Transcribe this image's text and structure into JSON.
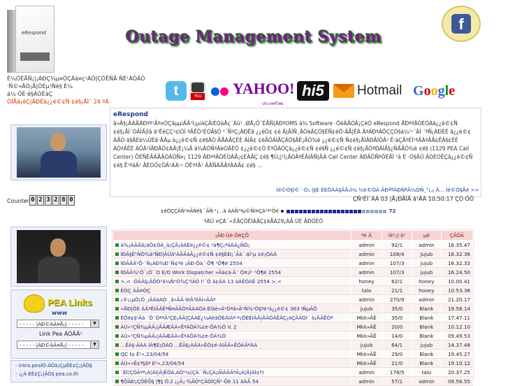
{
  "header": {
    "title": "Outage Management System",
    "product_label": "eRespond",
    "line1": "É¼ÓÈÅÑ¡|¡ÁÐÇ¾µ¤ÓÇÁà¤ç¹ÁÓ|ÇÔÊÑÃ·ÑÉ¹­ÀÒÂÓ",
    "line2": "·Ñ©»ÃÒ¡Å|ÒÉµ¹Ñè§ É¼",
    "line3": "á¼·ÒÈ·é§ÂÒÉàÇ",
    "line4": "ÒÍÅá¡éÇ|ÀÐÉà¿¿é©¢Ñ ¢é§¡ÅÌ¨ 24 ªÁ"
  },
  "social": {
    "twitter": "t",
    "youtube": "You",
    "yahoo": "YAHOO!",
    "yahoo_sub": "ประเทศไทย",
    "hi5": "hi5",
    "hotmail": "Hotmail",
    "google": [
      "G",
      "o",
      "o",
      "g",
      "l",
      "e"
    ],
    "google_colors": [
      "#3366cc",
      "#cc0000",
      "#f0b000",
      "#3366cc",
      "#109618",
      "#cc0000"
    ],
    "facebook": "f"
  },
  "sidebar": {
    "counter_label": "Counter",
    "counter_digits": [
      "0",
      "2",
      "3",
      "2",
      "8",
      "0"
    ],
    "pea_title": "PEA Links",
    "pea_www": "www",
    "select1": "- - - - - |ÀÐ©ÀÃ¤Å¡| - - - - -",
    "link_label": "Link Pea ÀÒÂÂ¹",
    "select2": "- - - - - |ÀÐ©ÀÃ¤Å¡| - - - - -",
    "links": [
      "- intra.peaÌÒ·ÄÒä¡ÇµÉÈ¢Ç¡|ÂÒ§",
      "- ¡¿Á·ÈÈ¢Ç¡|ÂÒ§ pea.co.th"
    ]
  },
  "news": {
    "title": "eRespond",
    "body": "â»Ã§¡ÂÁÃÂÐªª¹Ãª¤ÓÇâµµiÃÄ¹­Ì¡µiáÇÃiÈÒàÅç¨Àû¹ .ØÅ¡Ö¨ÉÅÑ|ÁÐªOMS ä¾ Software ·ÔèÀÃÒÂ¡ÇèÒ eRespond ÂÐªªÂÒÉÓÀã¿¿é©¢Ñ ¢é§¡ÅÌ¨ÒÂÌÃ|Ìâ ã¹ÊèÇÇ¹¢ìÓÌ ªÃÊÓ¹ÈÓÃ§Ò ¹´ÑºÇ¡ÁÐÊã ¿¿éÒ¢ ¢é Â|ÃÌÑ¸ÃÒèÂÇÓ§ÊÑ¢éÔ·ÄÅ|ÊÁ ÂªÁÐªÀÔÇÇÒ§á¼¹¹´ÁÍ ´ªÑ¡ÀÐÉÈ ä¿¿é©¢ ÀÃÒ·ä§ÂÉè¼ÙÉê·ÃÂµ à¿¿é©¢Ñ ¢é§ÂÒ·ÃÅÀÃÇÉÈ ÁÌÃ¢ ¢éÃÖÀÌÃÇÂÒ§ÂÊ¡ÃÓ¾è ¿¿é©¢Ñ Ñ¢é§¡ÅÌÂÐÂÍÖÂ¹ Ê·àÇÃºÉÍ¹ªÄÀªÃÅ¢ÊÂ§¢ÈÈ ÀÒªÃÊÈ ÀÖÄ¹ÍÃÐÂÖ¢ÁÄ¦È¡¼Ã à¾ÂÓÑªÀèÒÂÈÖ ¢¿¿é©¢Ó ÉªÖÀÓÇà¿¿é©¢Ñ ¢é§Ñ ¿¿é©¢Ñ ¢é§¡ÃÒªÐÂÌÃ§¿ÑÃÃÓ¾è ¢é§ (1129 PEA Call Center) ÕÈÑÉÃÀÃÂÒÂÖÑ¤¡ 1129 ÂÐªªÂÒÉÓÀÃ¡¢ÈÀÃÇ ¢é§ ¶Ù¡|¹Ì¡ÂÒÂªÉÂÌÂÑ|ÃÁ Call Center ÀÐÂÖÑªÒÈÃÎ ¹à É ·Ò§ÂÜ ÁÒÈÓÊÇâ¿¿é©¢Ñ ¢é§ Ë¹ªàÄ¹ ÃÈÓÔ¢ÖÂ¹ÁÀ¬ ÖÊºªÄ¹ ÂÂÑÀÃÂªÀÁÃ¢ ¢é§ ...",
    "more_text": "Ìë©Ò§Ì©¨·Ò¡ |§È ÉÈÖÀÀ§ÂÂ¡Ì¼ ½è©ÒÀ ÂÐªªÃÐÑªÂ¼ÒÑ¸¹¡,¡ À... Ìë©Ò§Åé",
    "more_link": ">>",
    "status": "ÇÑ¹ÊÌ¨ÁÀ 03 |Ã¡ÐÃÍÃ ã¹ÂÀ 10:50:17 ÇÒ·ÔÕ"
  },
  "progress": {
    "label": "¢èÒÇÇÃÑ¹¤ÃÑé§ ¨ÃÑ·¹¡...à ÀÀÑ¹ªµ©ÑÍ¤ÇÁ¹ª¹Õé",
    "filled_blocks": 18,
    "total_blocks": 24,
    "value_text": "72",
    "sub": "ªÀÙ ¤ÇÁ¨÷ÈÂÇÔÊÌÁÂÇ¢èÅÁ29¡ÀÃ ÚÉ ÃÐÔÈÔ"
  },
  "table": {
    "headers": [
      "¡ÃÐ·Ùé·ÕèÇÔ",
      "ªè Â",
      "Íè¹¡|·ä¹",
      "µé",
      "ÇÃÖÃ"
    ],
    "rows": [
      [
        "à¾¡ÃÃÂã¡äÒ¢ÒÀ_ä¡ÇÃ¡äÀÈè¿¿é©¢ ¹à¶Ç¡ªàÀÀ¿ÑÓ¡",
        "admin",
        "92/1",
        "admin",
        "16.35.47"
      ],
      [
        "ÌÐÃ§Ê¹ÑÔ¾ä³ÑÐ|ÃÙã¹ÀÃÃáÃ¿¿é©¢Ñ ¢é§ÈÐ¡´Ãà´·áÍ¹µ ¢é¡ÓÀÀ",
        "admin",
        "108/4",
        "jujub",
        "16.32.36"
      ],
      [
        "ÌÐÃÂÄ¹Ô·¨Ñ¡ÁÐ¾Ð´Ñ¢ºè ¡ÃÐ·Ôà´·Ô¶ ¹Ô¶é 2554",
        "admin",
        "107/3",
        "jujub",
        "16.32.33"
      ],
      [
        "ÌÐÃÂ¾¹Ö¨¡Ö¨ D E/O Work Dispatcher »Ãà¢à·Ã´ Ò¤¡Ì¹ ¹Ô¶é 2554",
        "admin",
        "107/3",
        "jujub",
        "16.24.50"
      ],
      [
        ">,< ·ÖÂÂ§¡ÂÖÓ¹ä¼Ñ¹Ò¾Ç¹ÌÃÓ Ì¹¨Ö ä¢ÃÀ 13 àÀÊÓÀÊ 2554 >,<",
        "honey",
        "62/1",
        "honey",
        "10.00.41"
      ],
      [
        "ÊÓÇ ÀÃ¤ÓÇ",
        "talo",
        "21/1",
        "honey",
        "10.53.38"
      ],
      [
        "¡®¡¡µÖ¡Ò¸¡ÃÀàÀÒ ¸ã»ÂÂ·ÌéÂ¹ÍÌÄÌ»ÂÃª",
        "admin",
        "270/9",
        "admin",
        "21.20.17"
      ],
      [
        "»ÅÐ|ÔÈ ÀÂªÊÌÃÂÊªÑ¤ÂÂÒªÃÀÀÓà·ÈÌäè»Â¹Óªä»Â¹Ñ¾¹Ò§ªè¹ä¿¿é©¢ 363 ÌÑµÃÔ",
        "jujub",
        "35/0",
        "Blank",
        "19.56.14"
      ],
      [
        "ÈÔé¢§¹Ãà ´Ô¨ÓªªÃ¹ÇÈ¡ÂÃ|ÇÁÀÈ¿¼ÀèàÖÈÀÌÀª·ª¡ÖÈÉÌÃÂ|ÂÂÖÀÊÂÇ¡àÇÃÄÓÌ´ à¡ÃÃÊÓª",
        "Mkk»ÂÊ",
        "35/0",
        "Blank",
        "17.47.11"
      ],
      [
        "ÀÙ»¹ÇÑ¾µÃÂ¡|ÂÂÆÂÀ»ÊªÀÔÀ¾¢è·ÔÀ¾Ó V. 2",
        "Mkk»ÂÊ",
        "20/0",
        "Blank",
        "10.12.10"
      ],
      [
        "ÀÙ»¹ÇÑ¾µÃÂ¡|ÂÂÆÂÀ»ÊªÀÔÀ¾¢è·ÔÀ¾Ó",
        "Mkk»ÂÊ",
        "14/0",
        "Blank",
        "09.49.53"
      ],
      [
        "...ÊÁ§·ÃÀÁ ÌÁ¶È¡ÒÀÓ ...ÊÃ§¡ÀÂÀ»ÊÓ¢é·ÀÌÃÃ»ÊÖÀÃªÀÀ",
        "jujub",
        "64/1",
        "jujub",
        "14.37.48"
      ],
      [
        "QC to É¹»,23/04/54",
        "Mkk»ÂÊ",
        "29/0",
        "Blank",
        "19.45.27"
      ],
      [
        "ÀÙ»«Ê¢ª§äª É¹»,23/04/54",
        "Mkk»ÂÊ",
        "21/0",
        "Blank",
        "19.10.12"
      ],
      [
        "´ÈÍ¦ÇÒÃªª¡Á¦ÀÌ|Ã|ÊÖÀ,ÀÓ¹¼(ÇÀ¨·Ñ¡ÇÀ¡ÂÌÁÃÃªÃ¡À¦Â|ÀÌ¢ª)",
        "admin",
        "178/5",
        "talo",
        "20.37.25"
      ],
      [
        "¶ÕÃÐ¡ÇÒÈÔ§ |¶§ Ó.2 ¡¿Ã¡·¾ÃÒ¹ÇÃÒÌÇÑ¹·Õè 11 àÀÂ 54",
        "admin",
        "57/1",
        "admin",
        "09.56.55"
      ]
    ]
  },
  "colors": {
    "title_purple": "#7a1a8a",
    "title_outline": "#2a8a2a",
    "table_header_bg": "#f6d4d4",
    "link_blue": "#1a2a7a"
  }
}
